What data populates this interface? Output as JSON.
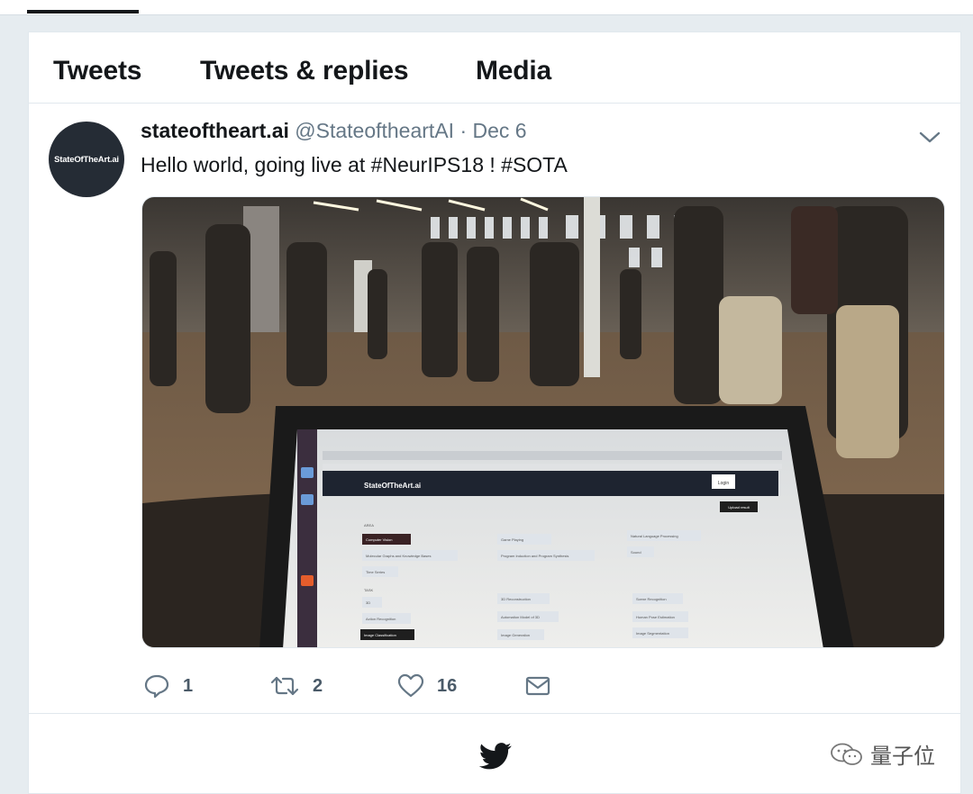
{
  "tabs": [
    {
      "label": "Tweets"
    },
    {
      "label": "Tweets & replies"
    },
    {
      "label": "Media"
    }
  ],
  "tweet": {
    "avatar_text": "StateOfTheArt.ai",
    "display_name": "stateoftheart.ai",
    "handle": "@StateoftheartAI",
    "separator": "·",
    "date": "Dec 6",
    "text": "Hello world, going live at #NeurIPS18 ! #SOTA",
    "photo": {
      "laptop_app_title": "StateOfTheArt.ai",
      "laptop_button": "Login",
      "laptop_button2": "Upload result",
      "section_area": "AREA",
      "section_task": "TASK",
      "area_chips": [
        "Computer Vision",
        "Molecular Graphs and Knowledge Bases",
        "Time Series",
        "Game Playing",
        "Program Induction and Program Synthesis",
        "Natural Language Processing",
        "Sound"
      ],
      "task_chips": [
        "3D",
        "Action Recognition",
        "Image Classification",
        "3D Reconstruction",
        "Automation Model of 3D",
        "Image Generation",
        "Scene Recognition",
        "Human Pose Estimation",
        "Image Segmentation"
      ]
    }
  },
  "actions": {
    "reply_count": "1",
    "retweet_count": "2",
    "like_count": "16"
  },
  "watermark": {
    "text": "量子位"
  },
  "icons": {
    "reply": "reply-icon",
    "retweet": "retweet-icon",
    "like": "heart-icon",
    "dm": "envelope-icon",
    "caret": "chevron-down-icon",
    "logo": "twitter-bird-icon"
  },
  "colors": {
    "background": "#e6ecf0",
    "secondary_text": "#657786",
    "primary_text": "#14171a"
  }
}
